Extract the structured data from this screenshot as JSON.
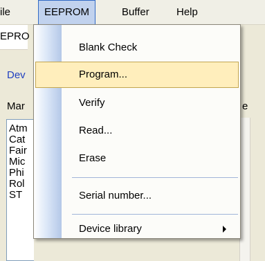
{
  "menubar": {
    "file": "ile",
    "eeprom": "EEPROM",
    "buffer": "Buffer",
    "help": "Help"
  },
  "background": {
    "tab_label": "EPRO",
    "device_label": "Dev",
    "manufacturer_label": "Mar",
    "right_label": "e",
    "manufacturers": [
      "Atm",
      "Cat",
      "Fair",
      "Mic",
      "Phi",
      "Rol",
      "ST"
    ]
  },
  "dropdown": {
    "items": [
      {
        "label": "Blank Check"
      },
      {
        "label": "Program..."
      },
      {
        "label": "Verify"
      },
      {
        "label": "Read..."
      },
      {
        "label": "Erase"
      },
      {
        "label": "Serial number..."
      },
      {
        "label": "Device library"
      }
    ],
    "highlighted_index": 1
  },
  "colors": {
    "highlight_fill": "#ffeebc",
    "highlight_border": "#c2a550",
    "open_menu_fill": "#c1d2ee",
    "device_label_color": "#2040c0"
  }
}
